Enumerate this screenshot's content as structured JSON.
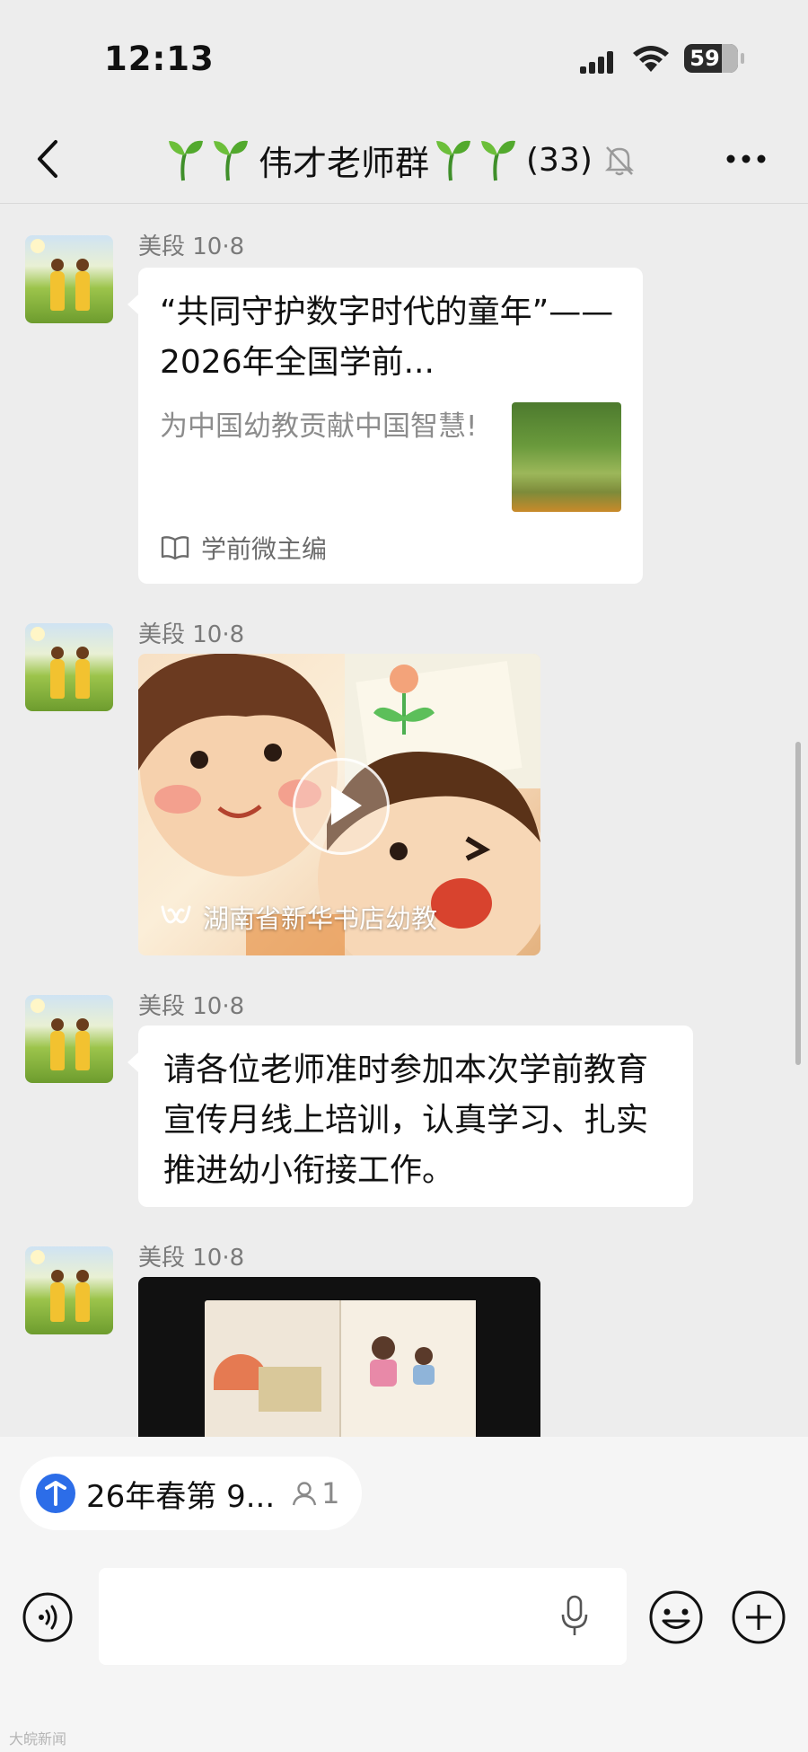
{
  "status_bar": {
    "time": "12:13",
    "battery": "59"
  },
  "header": {
    "back_icon": "chevron-left-icon",
    "title": "伟才老师群",
    "member_count": "(33)",
    "muted_icon": "bell-slash-icon",
    "more_icon": "more-dots-icon",
    "decoration_icon": "sprout-emoji"
  },
  "messages": [
    {
      "sender": "美段 10·8",
      "type": "link",
      "title": "“共同守护数字时代的童年”——2026年全国学前...",
      "description": "为中国幼教贡献中国智慧!",
      "source": "学前微主编",
      "source_icon": "open-book-icon"
    },
    {
      "sender": "美段 10·8",
      "type": "video",
      "caption": "湖南省新华书店幼教",
      "caption_icon": "channels-icon"
    },
    {
      "sender": "美段 10·8",
      "type": "text",
      "text": "请各位老师准时参加本次学前教育宣传月线上培训，认真学习、扎实推进幼小衔接工作。"
    },
    {
      "sender": "美段 10·8",
      "type": "video"
    }
  ],
  "pinned": {
    "text": "26年春第 9...",
    "participants": "1"
  },
  "input_bar": {
    "voice_icon": "voice-mode-icon",
    "mic_icon": "microphone-icon",
    "emoji_icon": "emoji-icon",
    "plus_icon": "plus-circle-icon"
  },
  "watermark": "大皖新闻"
}
